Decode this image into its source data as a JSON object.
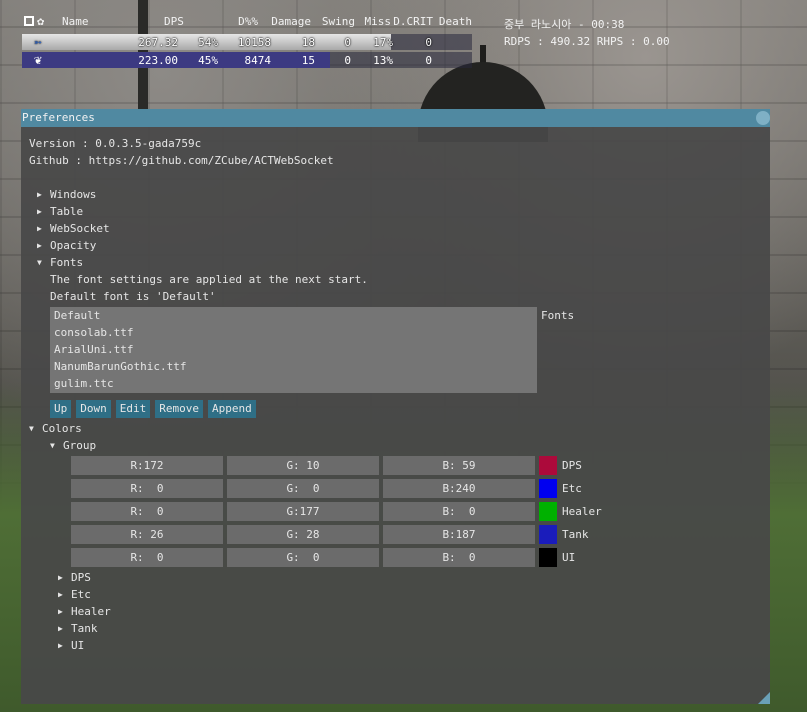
{
  "meter": {
    "headers": [
      "Name",
      "DPS",
      "D%%",
      "Damage",
      "Swing",
      "Miss",
      "D.CRIT",
      "Death"
    ],
    "icons": [
      "expand-icon",
      "gear-icon"
    ],
    "rows": [
      {
        "job_icon": "dragoon-job-icon",
        "dps": "267.32",
        "dpct": "54%",
        "damage": "10158",
        "swing": "18",
        "miss": "0",
        "dcrit": "17%",
        "death": "0",
        "share": 0.54,
        "color": "#b7b7b7"
      },
      {
        "job_icon": "chocobo-job-icon",
        "dps": "223.00",
        "dpct": "45%",
        "damage": "8474",
        "swing": "15",
        "miss": "0",
        "dcrit": "13%",
        "death": "0",
        "share": 0.45,
        "color": "#3c3a82"
      }
    ]
  },
  "encounter": {
    "title": "중부 라노시아 - 00:38",
    "stats": "RDPS : 490.32 RHPS : 0.00"
  },
  "prefs": {
    "title": "Preferences",
    "version": "Version : 0.0.3.5-gada759c",
    "github": "Github : https://github.com/ZCube/ACTWebSocket",
    "sections": {
      "windows": "Windows",
      "table": "Table",
      "websocket": "WebSocket",
      "opacity": "Opacity",
      "fonts": "Fonts",
      "colors": "Colors"
    },
    "fonts": {
      "note1": "The font settings are applied at the next start.",
      "note2": "Default font is 'Default'",
      "list": [
        "Default",
        "consolab.ttf",
        "ArialUni.ttf",
        "NanumBarunGothic.ttf",
        "gulim.ttc"
      ],
      "label": "Fonts",
      "buttons": {
        "up": "Up",
        "down": "Down",
        "edit": "Edit",
        "remove": "Remove",
        "append": "Append"
      }
    },
    "colors": {
      "group_label": "Group",
      "rows": [
        {
          "r": "R:172",
          "g": "G: 10",
          "b": "B: 59",
          "hex": "#ac0a3b",
          "label": "DPS"
        },
        {
          "r": "R:  0",
          "g": "G:  0",
          "b": "B:240",
          "hex": "#0000f0",
          "label": "Etc"
        },
        {
          "r": "R:  0",
          "g": "G:177",
          "b": "B:  0",
          "hex": "#00b100",
          "label": "Healer"
        },
        {
          "r": "R: 26",
          "g": "G: 28",
          "b": "B:187",
          "hex": "#1a1cbb",
          "label": "Tank"
        },
        {
          "r": "R:  0",
          "g": "G:  0",
          "b": "B:  0",
          "hex": "#000000",
          "label": "UI"
        }
      ],
      "subsections": [
        "DPS",
        "Etc",
        "Healer",
        "Tank",
        "UI"
      ]
    }
  }
}
